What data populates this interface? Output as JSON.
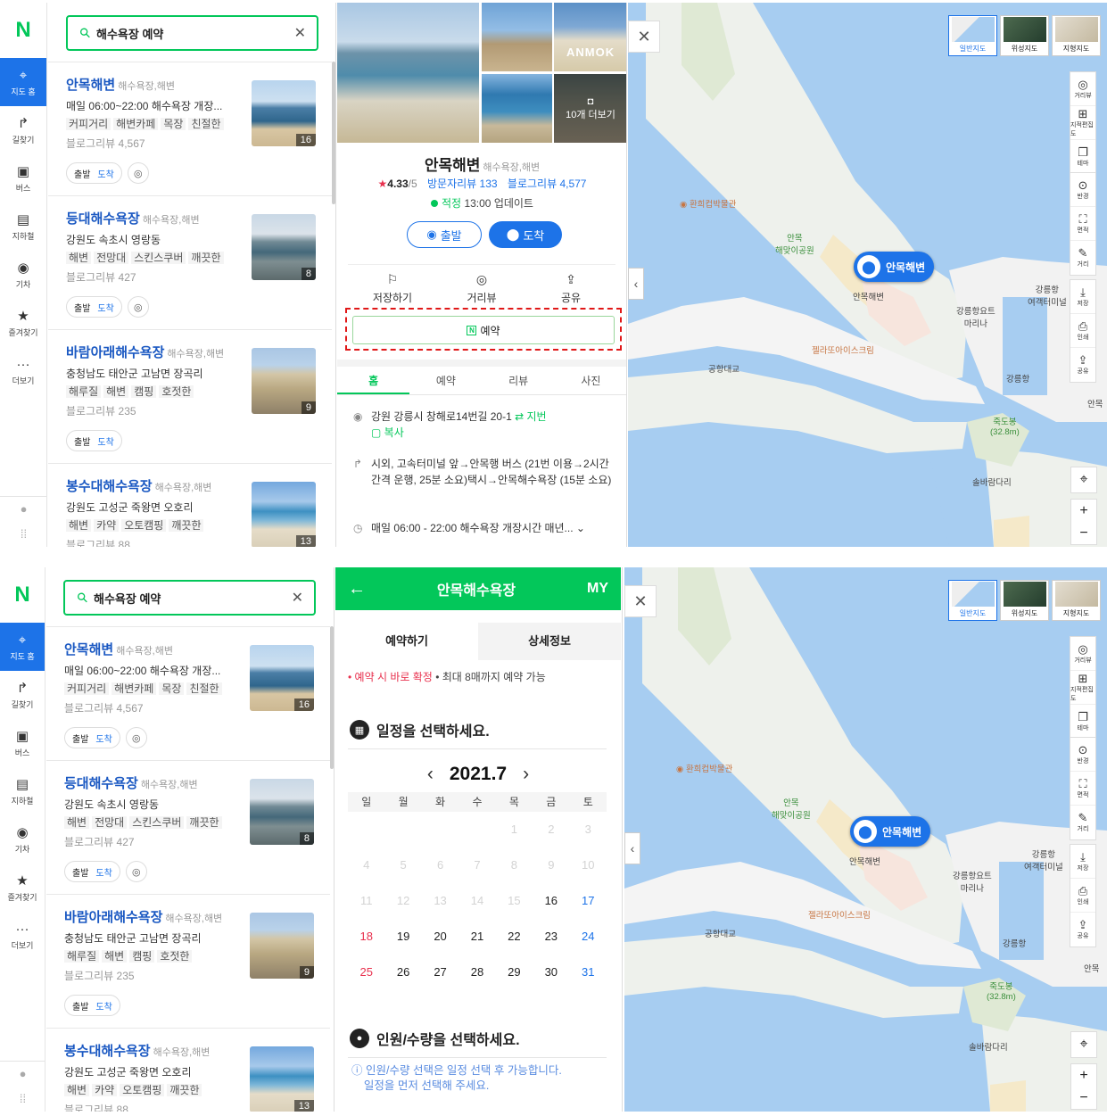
{
  "nav": {
    "logo": "N",
    "items": [
      {
        "label": "지도 홈",
        "icon": "map-home-icon",
        "active": true
      },
      {
        "label": "길찾기",
        "icon": "directions-icon"
      },
      {
        "label": "버스",
        "icon": "bus-icon"
      },
      {
        "label": "지하철",
        "icon": "subway-icon"
      },
      {
        "label": "기차",
        "icon": "train-icon"
      },
      {
        "label": "즐겨찾기",
        "icon": "star-icon"
      },
      {
        "label": "더보기",
        "icon": "more-icon"
      }
    ]
  },
  "search": {
    "value": "해수욕장 예약"
  },
  "results": [
    {
      "name": "안목해변",
      "category": "해수욕장,해변",
      "desc": "매일 06:00~22:00 해수욕장 개장...",
      "tags": [
        "커피거리",
        "해변카페",
        "목장",
        "친절한"
      ],
      "review": "블로그리뷰 4,567",
      "photo_count": "16"
    },
    {
      "name": "등대해수욕장",
      "category": "해수욕장,해변",
      "desc": "강원도 속초시 영랑동",
      "tags": [
        "해변",
        "전망대",
        "스킨스쿠버",
        "깨끗한"
      ],
      "review": "블로그리뷰 427",
      "photo_count": "8"
    },
    {
      "name": "바람아래해수욕장",
      "category": "해수욕장,해변",
      "desc": "충청남도 태안군 고남면 장곡리",
      "tags": [
        "해루질",
        "해변",
        "캠핑",
        "호젓한"
      ],
      "review": "블로그리뷰 235",
      "photo_count": "9"
    },
    {
      "name": "봉수대해수욕장",
      "category": "해수욕장,해변",
      "desc": "강원도 고성군 죽왕면 오호리",
      "tags": [
        "해변",
        "카약",
        "오토캠핑",
        "깨끗한"
      ],
      "review": "블로그리뷰 88",
      "photo_count": "13"
    }
  ],
  "result_buttons": {
    "depart": "출발",
    "arrive": "도착"
  },
  "detail": {
    "more_photos": "10개 더보기",
    "watermark": "ANMOK",
    "title": "안목해변",
    "category": "해수욕장,해변",
    "rating_star": "★",
    "rating": "4.33",
    "rating_max": "/5",
    "visitor_reviews": "방문자리뷰 133",
    "blog_reviews": "블로그리뷰 4,577",
    "live_status": "적정",
    "live_update": "13:00 업데이트",
    "depart": "출발",
    "arrive": "도착",
    "save": "저장하기",
    "distance": "거리뷰",
    "share": "공유",
    "reserve": "예약",
    "tabs": [
      "홈",
      "예약",
      "리뷰",
      "사진"
    ],
    "address": "강원 강릉시 창해로14번길 20-1",
    "address_toggle": "지번",
    "copy": "복사",
    "directions": "시외, 고속터미널 앞→안목행 버스 (21번 이용→2시간 간격 운행, 25분 소요)택시→안목해수욕장 (15분 소요)",
    "hours": "매일 06:00 - 22:00 해수욕장 개장시간 매년..."
  },
  "booking": {
    "title": "안목해수욕장",
    "my": "MY",
    "tabs": [
      "예약하기",
      "상세정보"
    ],
    "note_red": "예약 시 바로 확정",
    "note_rest": "• 최대 8매까지 예약 가능",
    "schedule_title": "일정을 선택하세요.",
    "month": "2021.7",
    "weekdays": [
      "일",
      "월",
      "화",
      "수",
      "목",
      "금",
      "토"
    ],
    "weeks": [
      [
        "",
        "",
        "",
        "",
        "1",
        "2",
        "3"
      ],
      [
        "4",
        "5",
        "6",
        "7",
        "8",
        "9",
        "10"
      ],
      [
        "11",
        "12",
        "13",
        "14",
        "15",
        "16",
        "17"
      ],
      [
        "18",
        "19",
        "20",
        "21",
        "22",
        "23",
        "24"
      ],
      [
        "25",
        "26",
        "27",
        "28",
        "29",
        "30",
        "31"
      ]
    ],
    "first_available": 16,
    "people_title": "인원/수량을 선택하세요.",
    "people_info_1": "인원/수량 선택은 일정 선택 후 가능합니다.",
    "people_info_2": "일정을 먼저 선택해 주세요."
  },
  "map": {
    "types": [
      "일반지도",
      "위성지도",
      "지형지도"
    ],
    "tools": [
      "거리뷰",
      "지적편집도",
      "테마",
      "반경",
      "면적",
      "거리",
      "저장",
      "인쇄",
      "공유"
    ],
    "pin_label": "안목해변",
    "labels": {
      "museum": "환희컵박물관",
      "park": "안목\n해맞이공원",
      "beach": "안목해변",
      "icecream": "젤라또아이스크림",
      "bridge": "공항대교",
      "yacht": "강릉항요트\n마리나",
      "terminal": "강릉항\n여객터미널",
      "port": "강릉항",
      "peak": "죽도봉\n(32.8m)",
      "bridge2": "솔바람다리",
      "anmok": "안목"
    }
  }
}
